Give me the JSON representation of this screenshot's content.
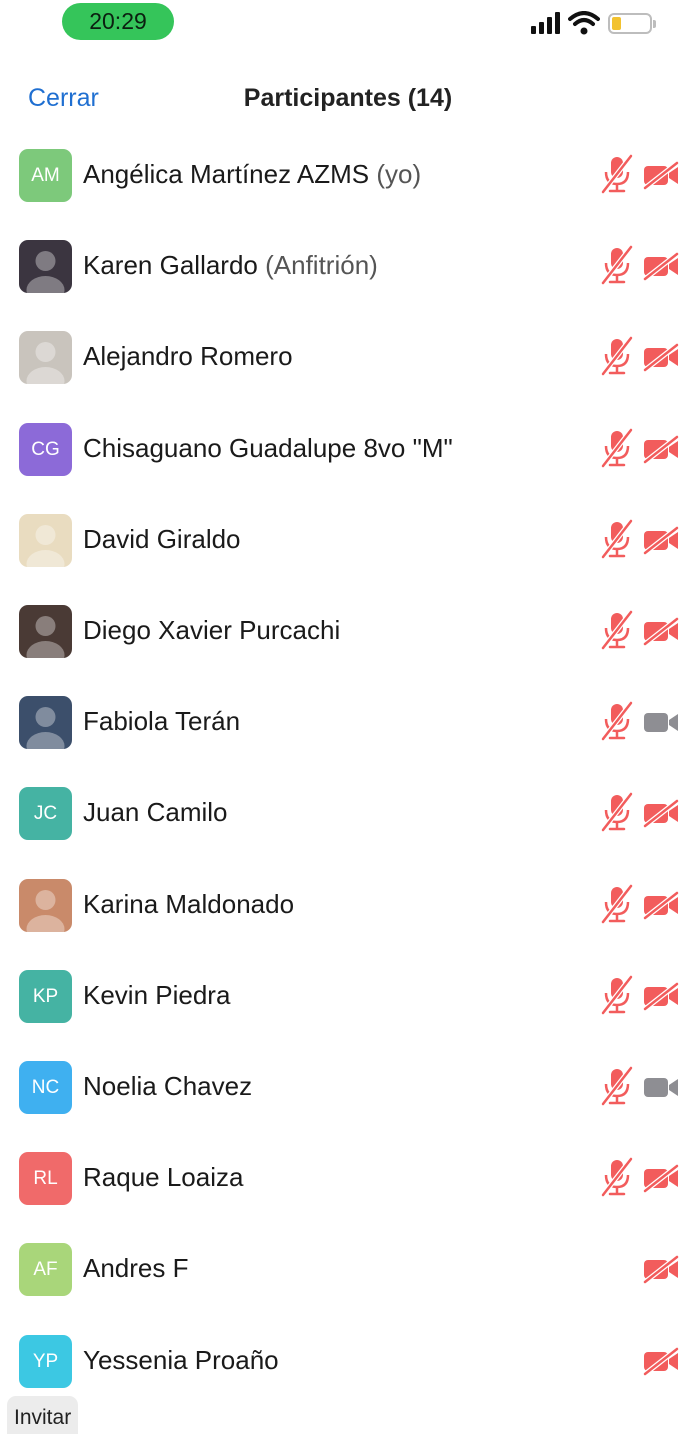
{
  "status_bar": {
    "time": "20:29",
    "time_pill_color": "#35c55a",
    "icons": [
      "signal-icon",
      "wifi-icon",
      "battery-icon"
    ]
  },
  "header": {
    "close_label": "Cerrar",
    "title": "Participantes (14)"
  },
  "colors": {
    "accent": "#1f6fd1",
    "muted_red": "#f25c5c",
    "video_on_gray": "#8e8e93"
  },
  "participants": [
    {
      "name": "Angélica Martínez AZMS",
      "role": "(yo)",
      "initials": "AM",
      "avatar_color": "#7dc97b",
      "mic": "muted",
      "video": "off"
    },
    {
      "name": "Karen Gallardo",
      "role": "(Anfitrión)",
      "initials": "",
      "avatar_color": "#3b3540",
      "mic": "muted",
      "video": "off"
    },
    {
      "name": "Alejandro Romero",
      "role": "",
      "initials": "",
      "avatar_color": "#c9c4bd",
      "mic": "muted",
      "video": "off"
    },
    {
      "name": "Chisaguano Guadalupe 8vo \"M\"",
      "role": "",
      "initials": "CG",
      "avatar_color": "#8c6ad8",
      "mic": "muted",
      "video": "off"
    },
    {
      "name": "David Giraldo",
      "role": "",
      "initials": "",
      "avatar_color": "#e9dcc0",
      "mic": "muted",
      "video": "off"
    },
    {
      "name": "Diego Xavier Purcachi",
      "role": "",
      "initials": "",
      "avatar_color": "#4a3a35",
      "mic": "muted",
      "video": "off"
    },
    {
      "name": "Fabiola Terán",
      "role": "",
      "initials": "",
      "avatar_color": "#3c4f6b",
      "mic": "muted",
      "video": "on"
    },
    {
      "name": "Juan Camilo",
      "role": "",
      "initials": "JC",
      "avatar_color": "#45b3a3",
      "mic": "muted",
      "video": "off"
    },
    {
      "name": "Karina Maldonado",
      "role": "",
      "initials": "",
      "avatar_color": "#c98a6a",
      "mic": "muted",
      "video": "off"
    },
    {
      "name": "Kevin Piedra",
      "role": "",
      "initials": "KP",
      "avatar_color": "#45b3a3",
      "mic": "muted",
      "video": "off"
    },
    {
      "name": "Noelia Chavez",
      "role": "",
      "initials": "NC",
      "avatar_color": "#3fb0f0",
      "mic": "muted",
      "video": "on"
    },
    {
      "name": "Raque Loaiza",
      "role": "",
      "initials": "RL",
      "avatar_color": "#f06a6a",
      "mic": "muted",
      "video": "off"
    },
    {
      "name": "Andres F",
      "role": "",
      "initials": "AF",
      "avatar_color": "#a9d67a",
      "mic": "none",
      "video": "off"
    },
    {
      "name": "Yessenia Proaño",
      "role": "",
      "initials": "YP",
      "avatar_color": "#3cc8e3",
      "mic": "none",
      "video": "off"
    }
  ],
  "footer": {
    "invite_label": "Invitar"
  }
}
